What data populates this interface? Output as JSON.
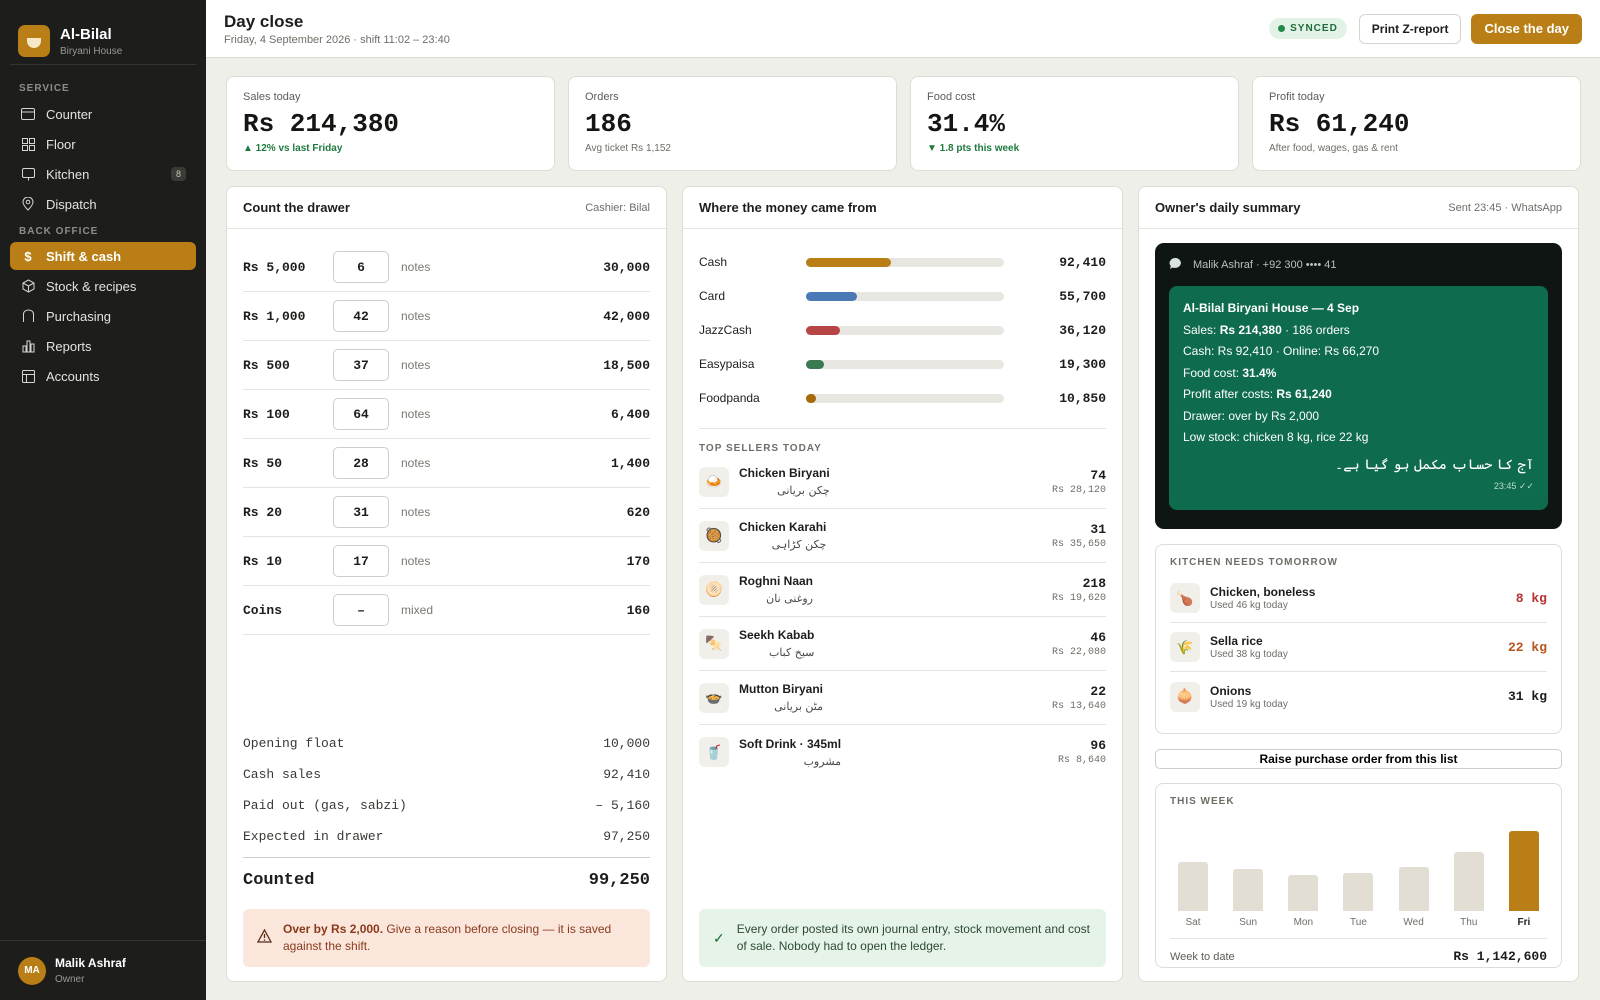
{
  "app": {
    "name": "Al-Bilal",
    "subtitle": "Biryani House"
  },
  "nav": {
    "service_heading": "SERVICE",
    "service_items": [
      {
        "label": "Counter",
        "icon": "counter-icon"
      },
      {
        "label": "Floor",
        "icon": "grid-icon"
      },
      {
        "label": "Kitchen",
        "icon": "monitor-icon",
        "badge": "8"
      },
      {
        "label": "Dispatch",
        "icon": "pin-icon"
      }
    ],
    "backoffice_heading": "BACK OFFICE",
    "backoffice_items": [
      {
        "label": "Shift & cash",
        "icon": "dollar-icon",
        "active": true
      },
      {
        "label": "Stock & recipes",
        "icon": "box-icon"
      },
      {
        "label": "Purchasing",
        "icon": "bag-icon"
      },
      {
        "label": "Reports",
        "icon": "bar-chart-icon"
      },
      {
        "label": "Accounts",
        "icon": "ledger-icon"
      }
    ]
  },
  "user": {
    "initials": "MA",
    "name": "Malik Ashraf",
    "role": "Owner"
  },
  "header": {
    "title": "Day close",
    "subtitle": "Friday, 4 September 2026 · shift 11:02 – 23:40",
    "status": "SYNCED",
    "print_label": "Print Z-report",
    "close_label": "Close the day"
  },
  "kpis": [
    {
      "label": "Sales today",
      "value": "Rs 214,380",
      "note": "▲ 12% vs last Friday",
      "good": true
    },
    {
      "label": "Orders",
      "value": "186",
      "note": "Avg ticket Rs 1,152",
      "good": false
    },
    {
      "label": "Food cost",
      "value": "31.4%",
      "note": "▼ 1.8 pts this week",
      "good": true
    },
    {
      "label": "Profit today",
      "value": "Rs 61,240",
      "note": "After food, wages, gas & rent",
      "good": false
    }
  ],
  "drawer": {
    "title": "Count the drawer",
    "cashier": "Cashier: Bilal",
    "rows": [
      {
        "den": "Rs 5,000",
        "count": "6",
        "unit": "notes",
        "amount": "30,000"
      },
      {
        "den": "Rs 1,000",
        "count": "42",
        "unit": "notes",
        "amount": "42,000"
      },
      {
        "den": "Rs 500",
        "count": "37",
        "unit": "notes",
        "amount": "18,500"
      },
      {
        "den": "Rs 100",
        "count": "64",
        "unit": "notes",
        "amount": "6,400"
      },
      {
        "den": "Rs 50",
        "count": "28",
        "unit": "notes",
        "amount": "1,400"
      },
      {
        "den": "Rs 20",
        "count": "31",
        "unit": "notes",
        "amount": "620"
      },
      {
        "den": "Rs 10",
        "count": "17",
        "unit": "notes",
        "amount": "170"
      },
      {
        "den": "Coins",
        "count": "–",
        "unit": "mixed",
        "amount": "160"
      }
    ],
    "recon": [
      {
        "label": "Opening float",
        "value": "10,000"
      },
      {
        "label": "Cash sales",
        "value": "92,410"
      },
      {
        "label": "Paid out (gas, sabzi)",
        "value": "– 5,160"
      },
      {
        "label": "Expected in drawer",
        "value": "97,250"
      }
    ],
    "counted_label": "Counted",
    "counted_value": "99,250",
    "alert_bold": "Over by Rs 2,000.",
    "alert_text": " Give a reason before closing — it is saved against the shift."
  },
  "money": {
    "title": "Where the money came from",
    "methods": [
      {
        "name": "Cash",
        "amount": "92,410",
        "share": 0.43,
        "color": "#b97e15"
      },
      {
        "name": "Card",
        "amount": "55,700",
        "share": 0.26,
        "color": "#4a7ab5"
      },
      {
        "name": "JazzCash",
        "amount": "36,120",
        "share": 0.17,
        "color": "#b84545"
      },
      {
        "name": "Easypaisa",
        "amount": "19,300",
        "share": 0.09,
        "color": "#3a7a52"
      },
      {
        "name": "Foodpanda",
        "amount": "10,850",
        "share": 0.05,
        "color": "#a56a0a"
      }
    ],
    "sellers_heading": "TOP SELLERS TODAY",
    "sellers": [
      {
        "name": "Chicken Biryani",
        "urdu": "چکن بریانی",
        "qty": "74",
        "revenue": "Rs 28,120",
        "icon": "biryani-icon",
        "glyph": "🍛"
      },
      {
        "name": "Chicken Karahi",
        "urdu": "چکن کڑاہی",
        "qty": "31",
        "revenue": "Rs 35,650",
        "icon": "karahi-icon",
        "glyph": "🥘"
      },
      {
        "name": "Roghni Naan",
        "urdu": "روغنی نان",
        "qty": "218",
        "revenue": "Rs 19,620",
        "icon": "naan-icon",
        "glyph": "🫓"
      },
      {
        "name": "Seekh Kabab",
        "urdu": "سیخ کباب",
        "qty": "46",
        "revenue": "Rs 22,080",
        "icon": "kabab-icon",
        "glyph": "🍢"
      },
      {
        "name": "Mutton Biryani",
        "urdu": "مٹن بریانی",
        "qty": "22",
        "revenue": "Rs 13,640",
        "icon": "mutton-biryani-icon",
        "glyph": "🍲"
      },
      {
        "name": "Soft Drink · 345ml",
        "urdu": "مشروب",
        "qty": "96",
        "revenue": "Rs 8,640",
        "icon": "drink-icon",
        "glyph": "🥤"
      }
    ],
    "footer": "Every order posted its own journal entry, stock movement and cost of sale. Nobody had to open the ledger."
  },
  "owner": {
    "title": "Owner's daily summary",
    "meta": "Sent 23:45 · WhatsApp",
    "recipient": "Malik Ashraf · +92 300 •••• 41",
    "msg_title": "Al-Bilal Biryani House — 4 Sep",
    "sales_label": "Sales: ",
    "sales_value": "Rs 214,380",
    "sales_rest": " · 186 orders",
    "cash_line": "Cash: Rs 92,410 · Online: Rs 66,270",
    "food_label": "Food cost: ",
    "food_value": "31.4%",
    "profit_label": "Profit after costs: ",
    "profit_value": "Rs 61,240",
    "drawer_line": "Drawer: over by Rs 2,000",
    "stock_line": "Low stock: chicken 8 kg, rice 22 kg",
    "urdu_line": "آج کا حساب مکمل ہو گیا ہے۔",
    "msg_time": "23:45 ✓✓"
  },
  "needs": {
    "heading": "KITCHEN NEEDS TOMORROW",
    "items": [
      {
        "name": "Chicken, boneless",
        "sub": "Used 46 kg today",
        "qty": "8 kg",
        "color": "#b83232",
        "icon": "chicken-icon",
        "glyph": "🍗"
      },
      {
        "name": "Sella rice",
        "sub": "Used 38 kg today",
        "qty": "22 kg",
        "color": "#b8541e",
        "icon": "rice-icon",
        "glyph": "🌾"
      },
      {
        "name": "Onions",
        "sub": "Used 19 kg today",
        "qty": "31 kg",
        "color": "#1d1d1b",
        "icon": "onion-icon",
        "glyph": "🧅"
      }
    ],
    "raise_label": "Raise purchase order from this list"
  },
  "week": {
    "heading": "THIS WEEK",
    "total_label": "Week to date",
    "total_value": "Rs 1,142,600"
  },
  "chart_data": {
    "type": "bar",
    "categories": [
      "Sat",
      "Sun",
      "Mon",
      "Tue",
      "Wed",
      "Thu",
      "Fri"
    ],
    "values": [
      0.61,
      0.52,
      0.45,
      0.48,
      0.55,
      0.74,
      1.0
    ],
    "highlight": "Fri",
    "colors": {
      "normal": "#e2ded3",
      "highlight": "#b97e15"
    }
  }
}
